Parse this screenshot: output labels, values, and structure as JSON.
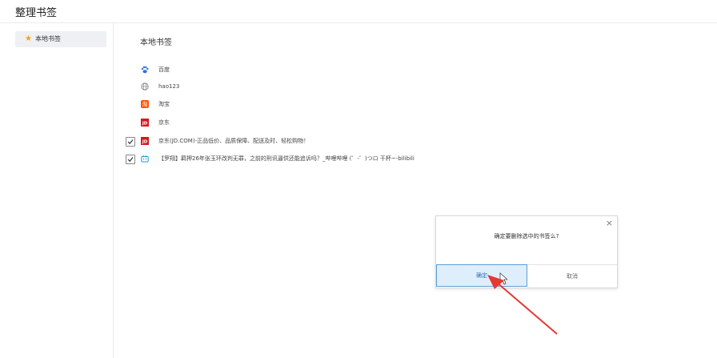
{
  "header": {
    "title": "整理书签"
  },
  "sidebar": {
    "items": [
      {
        "label": "本地书签",
        "icon": "star-icon",
        "color": "#f4a11c"
      }
    ]
  },
  "main": {
    "section_title": "本地书签",
    "bookmarks": [
      {
        "label": "百度",
        "icon": "baidu-paw-icon",
        "checked": false
      },
      {
        "label": "hao123",
        "icon": "globe-icon",
        "checked": false
      },
      {
        "label": "淘宝",
        "icon": "taobao-icon",
        "checked": false
      },
      {
        "label": "京东",
        "icon": "jd-icon",
        "checked": false
      },
      {
        "label": "京东(JD.COM)-正品低价、品质保障、配送及时、轻松购物！",
        "icon": "jd-icon",
        "checked": true
      },
      {
        "label": "【罗翔】羁押26年张玉环改判无罪，之前的刑讯逼供还能追诉吗？_哔哩哔哩 (゜-゜)つロ 干杯~-bilibili",
        "icon": "bilibili-icon",
        "checked": true
      }
    ]
  },
  "dialog": {
    "message": "确定要删除选中的书签么?",
    "confirm_label": "确定",
    "cancel_label": "取消",
    "close_symbol": "×"
  },
  "colors": {
    "accent": "#2f6fb5",
    "confirm_bg": "#dfeefc",
    "arrow": "#e53935",
    "jd_red": "#d71921"
  }
}
